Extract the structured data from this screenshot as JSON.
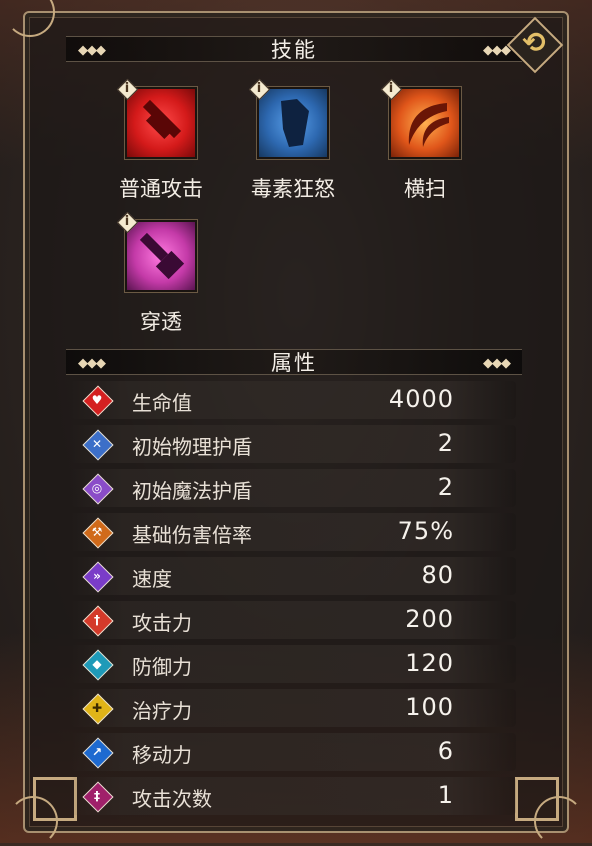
{
  "skills_section": {
    "title": "技能"
  },
  "skills": [
    {
      "label": "普通攻击",
      "icon": "sword-icon",
      "color": "#d41a1a"
    },
    {
      "label": "毒素狂怒",
      "icon": "poison-claw-icon",
      "color": "#2d68b0"
    },
    {
      "label": "横扫",
      "icon": "sweep-slash-icon",
      "color": "#e0561a"
    },
    {
      "label": "穿透",
      "icon": "pierce-hammer-icon",
      "color": "#c43aa8"
    }
  ],
  "attributes_section": {
    "title": "属性"
  },
  "attributes": [
    {
      "name": "生命值",
      "value": "4000",
      "icon": "heart-icon",
      "color": "#d42020"
    },
    {
      "name": "初始物理护盾",
      "value": "2",
      "icon": "physical-shield-icon",
      "color": "#3c6fc8"
    },
    {
      "name": "初始魔法护盾",
      "value": "2",
      "icon": "magic-shield-icon",
      "color": "#8a4cc8"
    },
    {
      "name": "基础伤害倍率",
      "value": "75%",
      "icon": "damage-multiplier-icon",
      "color": "#d06a1a"
    },
    {
      "name": "速度",
      "value": "80",
      "icon": "speed-icon",
      "color": "#7a3cc8"
    },
    {
      "name": "攻击力",
      "value": "200",
      "icon": "attack-icon",
      "color": "#d43a2a"
    },
    {
      "name": "防御力",
      "value": "120",
      "icon": "defense-icon",
      "color": "#1e9ab8"
    },
    {
      "name": "治疗力",
      "value": "100",
      "icon": "heal-icon",
      "color": "#e0b418"
    },
    {
      "name": "移动力",
      "value": "6",
      "icon": "movement-icon",
      "color": "#1e6ad0"
    },
    {
      "name": "攻击次数",
      "value": "1",
      "icon": "attack-count-icon",
      "color": "#a0206a"
    }
  ]
}
